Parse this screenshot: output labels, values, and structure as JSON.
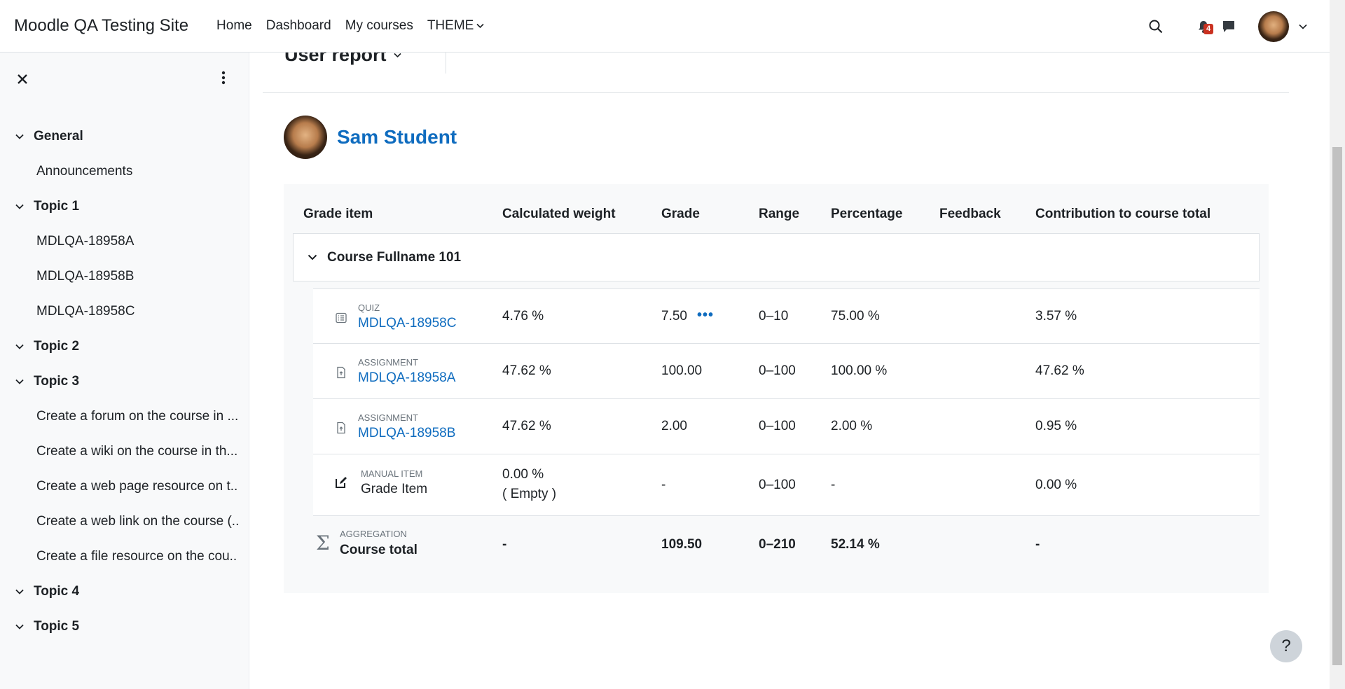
{
  "navbar": {
    "brand": "Moodle QA Testing Site",
    "links": [
      {
        "label": "Home"
      },
      {
        "label": "Dashboard"
      },
      {
        "label": "My courses"
      },
      {
        "label": "THEME"
      }
    ],
    "notification_count": "4"
  },
  "drawer": {
    "items": [
      {
        "kind": "section",
        "label": "General"
      },
      {
        "kind": "activity",
        "label": "Announcements"
      },
      {
        "kind": "section",
        "label": "Topic 1"
      },
      {
        "kind": "activity",
        "label": "MDLQA-18958A"
      },
      {
        "kind": "activity",
        "label": "MDLQA-18958B"
      },
      {
        "kind": "activity",
        "label": "MDLQA-18958C"
      },
      {
        "kind": "section",
        "label": "Topic 2"
      },
      {
        "kind": "section",
        "label": "Topic 3"
      },
      {
        "kind": "activity",
        "label": "Create a forum on the course in ..."
      },
      {
        "kind": "activity",
        "label": "Create a wiki on the course in th..."
      },
      {
        "kind": "activity",
        "label": "Create a web page resource on t..."
      },
      {
        "kind": "activity",
        "label": "Create a web link on the course (..."
      },
      {
        "kind": "activity",
        "label": "Create a file resource on the cou..."
      },
      {
        "kind": "section",
        "label": "Topic 4"
      },
      {
        "kind": "section",
        "label": "Topic 5"
      }
    ]
  },
  "report": {
    "title": "User report",
    "student_name": "Sam Student",
    "headers": {
      "grade_item": "Grade item",
      "weight": "Calculated weight",
      "grade": "Grade",
      "range": "Range",
      "percentage": "Percentage",
      "feedback": "Feedback",
      "contribution": "Contribution to course total"
    },
    "category": "Course Fullname 101",
    "items": [
      {
        "type": "QUIZ",
        "name": "MDLQA-18958C",
        "weight": "4.76 %",
        "grade": "7.50",
        "range": "0–10",
        "percentage": "75.00 %",
        "contribution": "3.57 %"
      },
      {
        "type": "ASSIGNMENT",
        "name": "MDLQA-18958A",
        "weight": "47.62 %",
        "grade": "100.00",
        "range": "0–100",
        "percentage": "100.00 %",
        "contribution": "47.62 %"
      },
      {
        "type": "ASSIGNMENT",
        "name": "MDLQA-18958B",
        "weight": "47.62 %",
        "grade": "2.00",
        "range": "0–100",
        "percentage": "2.00 %",
        "contribution": "0.95 %"
      },
      {
        "type": "MANUAL ITEM",
        "name": "Grade Item",
        "weight": "0.00 %",
        "weight_note": "( Empty )",
        "grade": "-",
        "range": "0–100",
        "percentage": "-",
        "contribution": "0.00 %"
      }
    ],
    "total": {
      "type": "AGGREGATION",
      "name": "Course total",
      "weight": "-",
      "grade": "109.50",
      "range": "0–210",
      "percentage": "52.14 %",
      "contribution": "-"
    },
    "actions_glyph": "•••"
  },
  "help": {
    "label": "?"
  }
}
